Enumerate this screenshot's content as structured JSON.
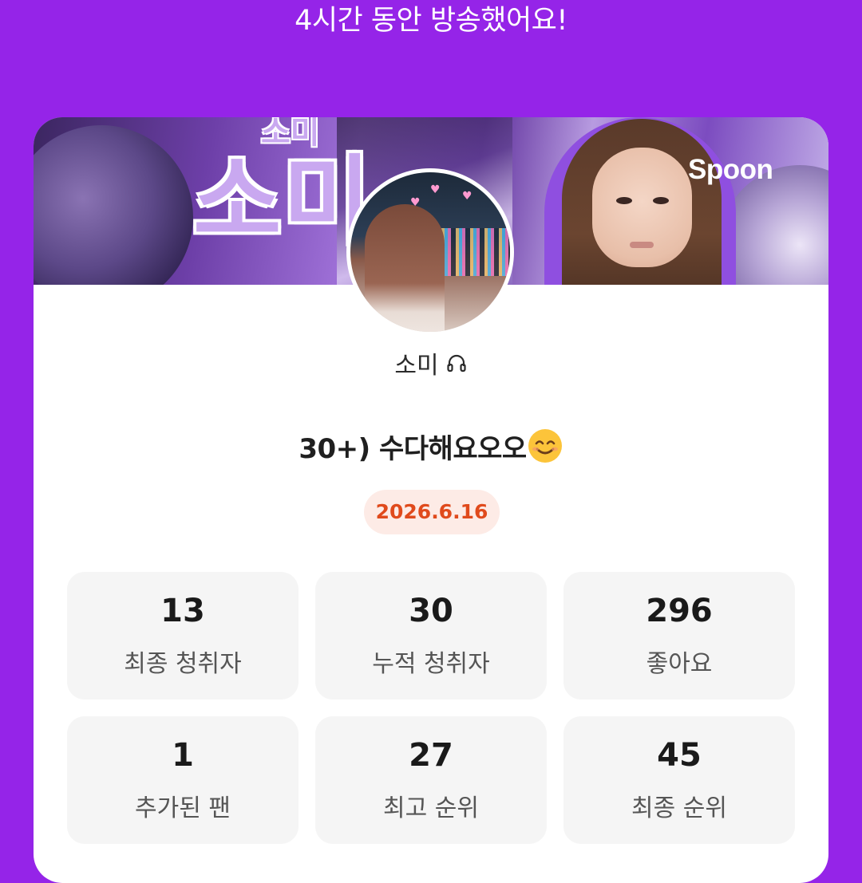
{
  "header": {
    "headline": "4시간 동안 방송했어요!"
  },
  "banner": {
    "big_text": "소미",
    "small_text": "소미",
    "logo": "Spoon"
  },
  "profile": {
    "nickname": "소미",
    "icon": "headphones-icon"
  },
  "broadcast": {
    "title": "30+) 수다해요오오",
    "emoji": "smiling-face-emoji",
    "date": "2026.6.16"
  },
  "stats": [
    {
      "value": "13",
      "label": "최종 청취자"
    },
    {
      "value": "30",
      "label": "누적 청취자"
    },
    {
      "value": "296",
      "label": "좋아요"
    },
    {
      "value": "1",
      "label": "추가된 팬"
    },
    {
      "value": "27",
      "label": "최고 순위"
    },
    {
      "value": "45",
      "label": "최종 순위"
    }
  ],
  "colors": {
    "background": "#9524e8",
    "card": "#ffffff",
    "date_text": "#e04a1c",
    "date_badge": "#fdebe6",
    "stat_box": "#f5f5f5"
  }
}
